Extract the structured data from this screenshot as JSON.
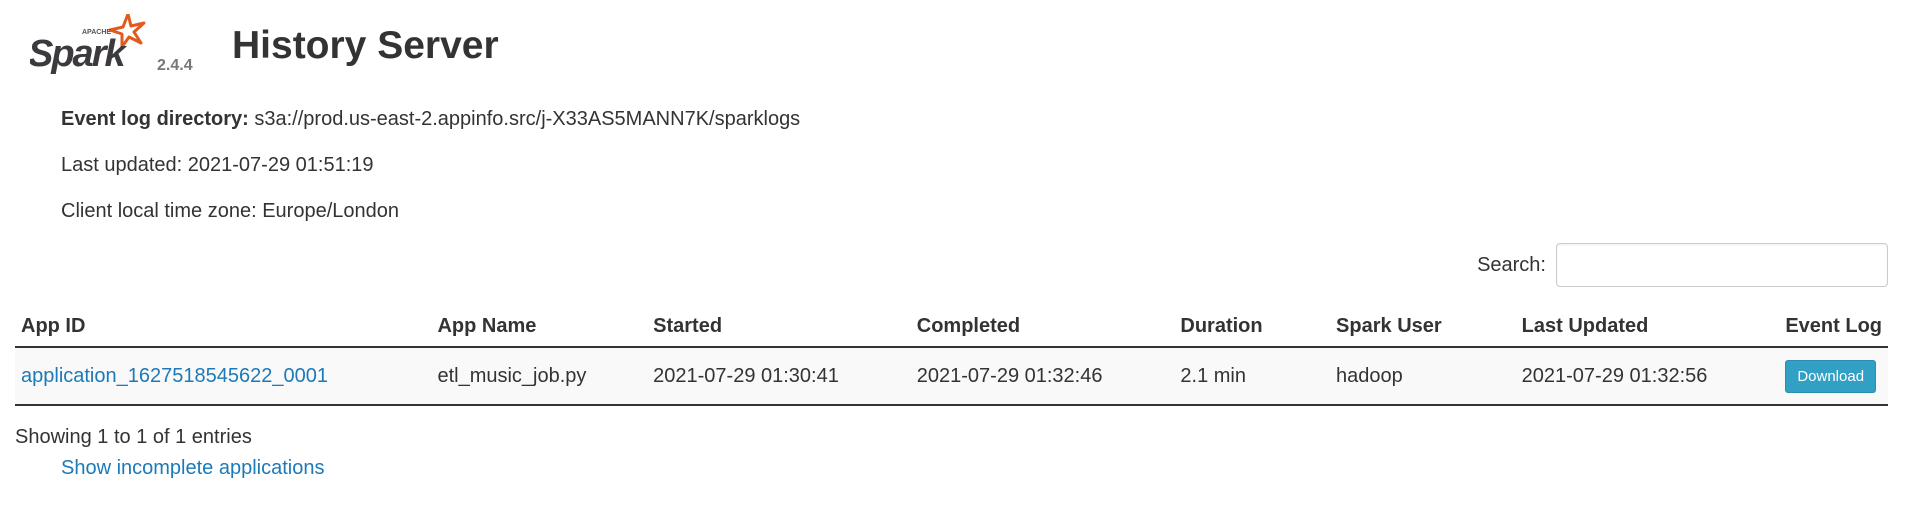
{
  "header": {
    "logo_text": "Spark",
    "logo_subtext": "APACHE",
    "version": "2.4.4",
    "title": "History Server"
  },
  "info": {
    "event_log_dir_label": "Event log directory:",
    "event_log_dir_value": "s3a://prod.us-east-2.appinfo.src/j-X33AS5MANN7K/sparklogs",
    "last_updated_label": "Last updated:",
    "last_updated_value": "2021-07-29 01:51:19",
    "timezone_label": "Client local time zone:",
    "timezone_value": "Europe/London"
  },
  "search": {
    "label": "Search:",
    "value": ""
  },
  "table": {
    "columns": [
      "App ID",
      "App Name",
      "Started",
      "Completed",
      "Duration",
      "Spark User",
      "Last Updated",
      "Event Log"
    ],
    "rows": [
      {
        "app_id": "application_1627518545622_0001",
        "app_name": "etl_music_job.py",
        "started": "2021-07-29 01:30:41",
        "completed": "2021-07-29 01:32:46",
        "duration": "2.1 min",
        "spark_user": "hadoop",
        "last_updated": "2021-07-29 01:32:56",
        "event_log_button": "Download"
      }
    ]
  },
  "footer": {
    "entries_text": "Showing 1 to 1 of 1 entries",
    "show_incomplete_link": "Show incomplete applications"
  },
  "colors": {
    "link": "#1c7ab9",
    "button": "#31a0c4",
    "logo_orange": "#e25a1c"
  }
}
